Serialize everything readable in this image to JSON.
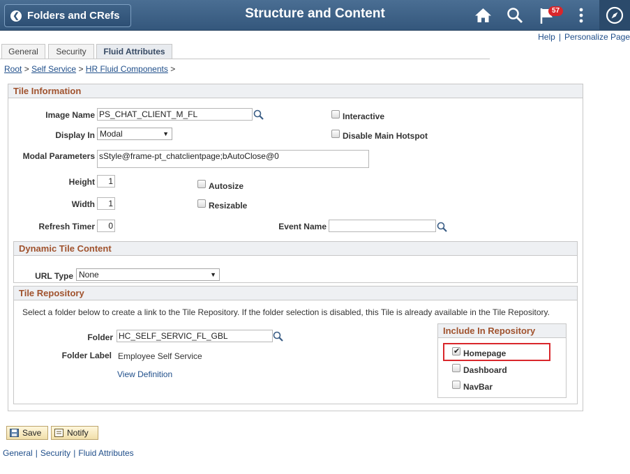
{
  "header": {
    "back_label": "Folders and CRefs",
    "title": "Structure and Content",
    "notification_count": "57"
  },
  "toplinks": {
    "help": "Help",
    "personalize": "Personalize Page"
  },
  "tabs": [
    {
      "label": "General"
    },
    {
      "label": "Security"
    },
    {
      "label": "Fluid Attributes",
      "active": true
    }
  ],
  "breadcrumb": [
    "Root",
    "Self Service",
    "HR Fluid Components"
  ],
  "breadcrumb_sep": ">",
  "tile_info": {
    "heading": "Tile Information",
    "image_name_label": "Image Name",
    "image_name_value": "PS_CHAT_CLIENT_M_FL",
    "display_in_label": "Display In",
    "display_in_value": "Modal",
    "modal_params_label": "Modal Parameters",
    "modal_params_value": "sStyle@frame-pt_chatclientpage;bAutoClose@0",
    "height_label": "Height",
    "height_value": "1",
    "width_label": "Width",
    "width_value": "1",
    "refresh_label": "Refresh Timer",
    "refresh_value": "0",
    "event_name_label": "Event Name",
    "event_name_value": "",
    "interactive_label": "Interactive",
    "disable_hotspot_label": "Disable Main Hotspot",
    "autosize_label": "Autosize",
    "resizable_label": "Resizable"
  },
  "dynamic": {
    "heading": "Dynamic Tile Content",
    "url_type_label": "URL Type",
    "url_type_value": "None"
  },
  "repository": {
    "heading": "Tile Repository",
    "instructions": "Select a folder below to create a link to the Tile Repository. If the folder selection is disabled, this Tile is already available in the Tile Repository.",
    "folder_label": "Folder",
    "folder_value": "HC_SELF_SERVIC_FL_GBL",
    "folder_label_label": "Folder Label",
    "folder_label_value": "Employee Self Service",
    "view_definition": "View Definition",
    "include_heading": "Include In Repository",
    "homepage_label": "Homepage",
    "homepage_checked": true,
    "dashboard_label": "Dashboard",
    "navbar_label": "NavBar"
  },
  "buttons": {
    "save": "Save",
    "notify": "Notify"
  },
  "bottom_links": [
    "General",
    "Security",
    "Fluid Attributes"
  ],
  "colors": {
    "header": "#3d6186",
    "section_title": "#a0522d",
    "link": "#1f4e8a",
    "highlight": "#d9262b"
  }
}
